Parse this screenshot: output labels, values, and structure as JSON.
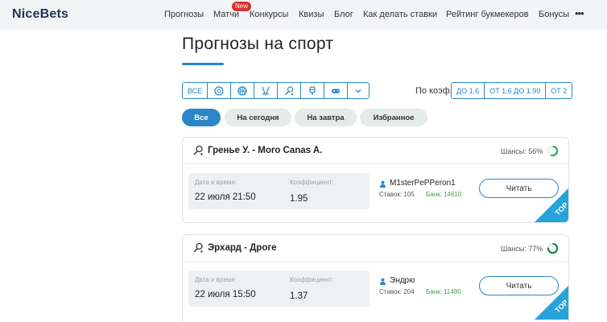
{
  "header": {
    "logo": "NiceBets",
    "nav": [
      "Прогнозы",
      "Матчи",
      "Конкурсы",
      "Квизы",
      "Блог",
      "Как делать ставки",
      "Рейтинг букмекеров",
      "Бонусы"
    ],
    "new_badge": "New",
    "more": "•••"
  },
  "page": {
    "title": "Прогнозы на спорт"
  },
  "filters": {
    "all_label": "ВСЕ",
    "sports": [
      "soccer-ball-icon",
      "basketball-icon",
      "hockey-icon",
      "tennis-icon",
      "table-tennis-icon",
      "esports-icon",
      "chevron-down-icon"
    ],
    "coef_label": "По коэф.",
    "coef_options": [
      "ДО 1.6",
      "ОТ 1.6 ДО 1.99",
      "ОТ 2"
    ]
  },
  "tabs": [
    "Все",
    "На сегодня",
    "На завтра",
    "Избранное"
  ],
  "cards": [
    {
      "match": "Гренье У.  -  Moro Canas A.",
      "chance_text": "Шансы: 56%",
      "chance": 56,
      "date_label": "Дата и время:",
      "date_value": "22 июля 21:50",
      "coef_label": "Коэффициент:",
      "coef_value": "1.95",
      "user": "M1sterPePPeron1",
      "stavok": "Ставок: 105",
      "bank": "Банк: 14610",
      "read": "Читать",
      "badge": "TOP"
    },
    {
      "match": "Эрхард  -  Дроге",
      "chance_text": "Шансы: 77%",
      "chance": 77,
      "date_label": "Дата и время:",
      "date_value": "22 июля 15:50",
      "coef_label": "Коэффициент:",
      "coef_value": "1.37",
      "user": "Эндрю",
      "stavok": "Ставок: 204",
      "bank": "Банк: 11480",
      "read": "Читать",
      "badge": "TOP"
    }
  ],
  "colors": {
    "accent": "#2a86c7",
    "ribbon": "#27a3d9",
    "chance_ring": "#2fae5b",
    "bank": "#46a049",
    "badge": "#d6332f"
  }
}
